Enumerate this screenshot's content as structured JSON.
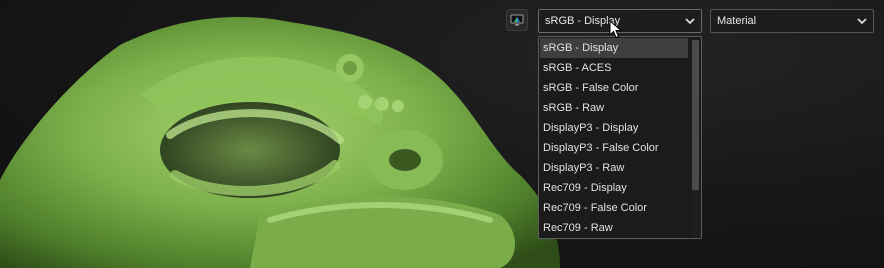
{
  "toolbar": {
    "display_icon": "monitor-color-icon",
    "colorspace_value": "sRGB - Display",
    "material_value": "Material",
    "chevron_icon": "chevron-down-icon"
  },
  "colorspace_dropdown": {
    "selected_index": 0,
    "options": [
      "sRGB - Display",
      "sRGB - ACES",
      "sRGB - False Color",
      "sRGB - Raw",
      "DisplayP3 - Display",
      "DisplayP3 - False Color",
      "DisplayP3 - Raw",
      "Rec709 - Display",
      "Rec709 - False Color",
      "Rec709 - Raw"
    ]
  },
  "viewport": {
    "subject": "green-creature-3d-model"
  },
  "colors": {
    "background": "#151515",
    "model_green": "#7fb54f",
    "selected_row": "#3f3f3f",
    "border": "#5d5d5d"
  }
}
